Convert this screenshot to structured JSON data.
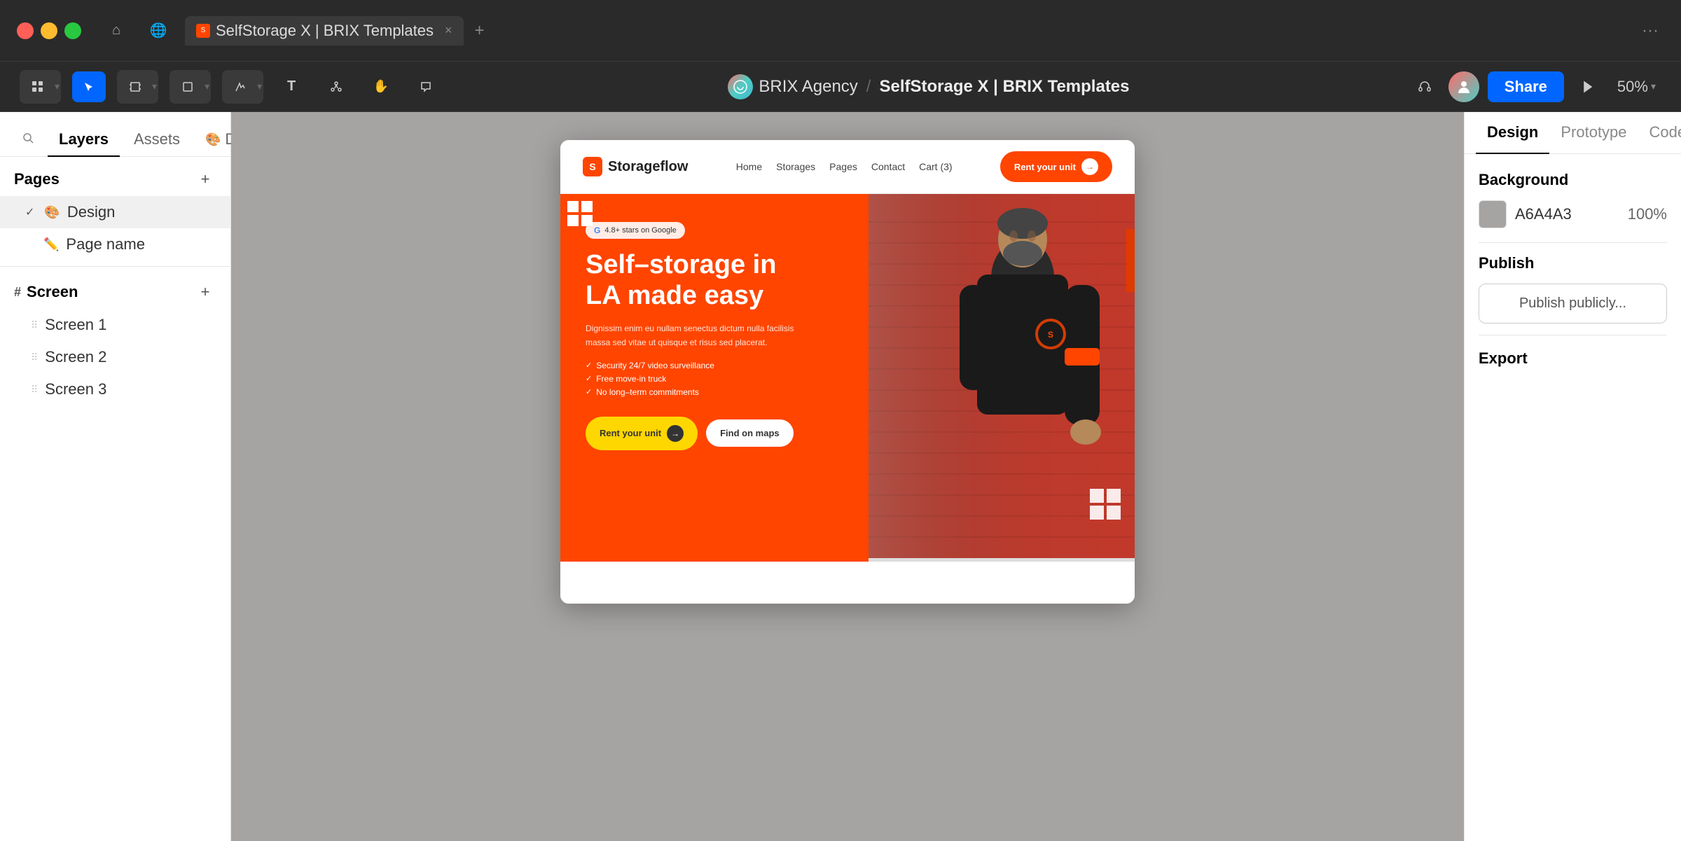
{
  "titlebar": {
    "traffic_lights": [
      "red",
      "yellow",
      "green"
    ],
    "tab_title": "SelfStorage X | BRIX Templates",
    "tab_close": "×",
    "new_tab": "+",
    "more": "···"
  },
  "toolbar": {
    "breadcrumb_org": "BRIX Agency",
    "breadcrumb_sep": "/",
    "breadcrumb_page": "SelfStorage X | BRIX Templates",
    "share_label": "Share",
    "zoom_level": "50%"
  },
  "left_panel": {
    "tabs": {
      "layers": "Layers",
      "assets": "Assets",
      "design": "Design"
    },
    "pages_section": "Pages",
    "add_page": "+",
    "pages": [
      {
        "label": "Design",
        "active": true
      },
      {
        "label": "Page name",
        "active": false
      }
    ],
    "screen_section": "Screen",
    "screens": [
      {
        "label": "Screen 1"
      },
      {
        "label": "Screen 2"
      },
      {
        "label": "Screen 3"
      }
    ]
  },
  "website": {
    "logo": "Storageflow",
    "nav": [
      "Home",
      "Storages",
      "Pages",
      "Contact",
      "Cart (3)"
    ],
    "rent_btn": "Rent your unit",
    "hero": {
      "badge": "4.8+ stars on Google",
      "title_line1": "Self–storage in",
      "title_line2": "LA made easy",
      "description": "Dignissim enim eu nullam senectus dictum nulla facilisis massa sed vitae ut quisque et risus sed placerat.",
      "features": [
        "Security 24/7 video surveillance",
        "Free move-in truck",
        "No long–term commitments"
      ],
      "rent_btn": "Rent your unit",
      "map_btn": "Find on maps"
    }
  },
  "right_panel": {
    "tabs": [
      "Design",
      "Prototype",
      "Code"
    ],
    "active_tab": "Design",
    "background_section": "Background",
    "color_hex": "A6A4A3",
    "color_opacity": "100%",
    "publish_section": "Publish",
    "publish_btn": "Publish publicly...",
    "export_section": "Export"
  }
}
